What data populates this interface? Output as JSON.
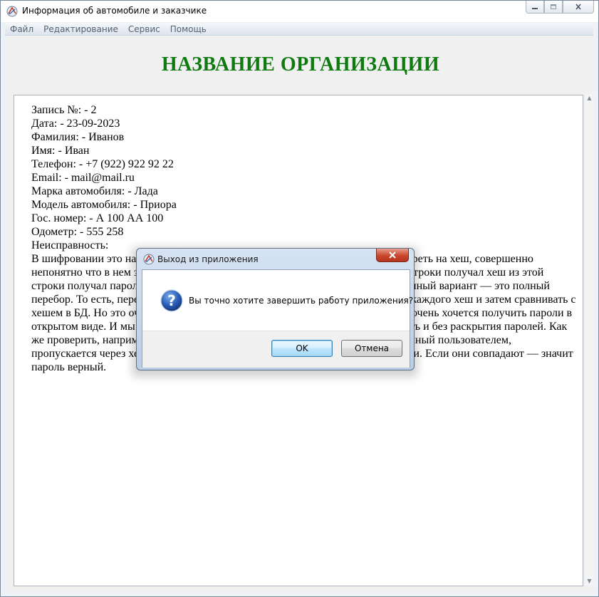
{
  "window": {
    "title": "Информация об автомобиле и заказчике"
  },
  "menu": [
    "Файл",
    "Редактирование",
    "Сервис",
    "Помощь"
  ],
  "header": {
    "org_title": "НАЗВАНИЕ ОРГАНИЗАЦИИ",
    "title_color": "#0f7a0f"
  },
  "record": {
    "lines": [
      "Запись №: - 2",
      "Дата: - 23-09-2023",
      "Фамилия: - Иванов",
      "Имя: - Иван",
      "Телефон: - +7 (922) 922 92 22",
      "Email: - mail@mail.ru",
      "Марка автомобиля: - Лада",
      "Модель автомобиля: - Приора",
      "Гос. номер: - А 100 АА 100",
      "Одометр: - 555 258",
      "Неисправность:"
    ],
    "description": "В шифровании это название используется для хранения паролей. Если посмотреть на хеш, совершенно непонятно что в нем записано. Причем я, например, не могу узнать, из какой строки получал хеш из этой строки получал пароль 12345. Поэтому, у злоумышленника остается единственный вариант — это полный перебор. То есть, перебирать все возможные варианты паролей, вычислять от каждого хеш и затем сравнивать с хешем в БД. Но это очень долгий и сложный путь. Поэтому злоумышленнику очень хочется получить пароли в открытом виде. И мы им такой радости не доставим, все нужное можно сделать и без раскрытия паролей. Как же проверить, например, корректность ввода пароля? Для этого, пароль введенный пользователем, пропускается через хеш-функцию и, затем, сравниваются между собой их хеши. Если они совпадают — значит пароль верный."
  },
  "dialog": {
    "title": "Выход из приложения",
    "message": "Вы точно хотите завершить работу приложения?",
    "ok_label": "OK",
    "cancel_label": "Отмена"
  }
}
